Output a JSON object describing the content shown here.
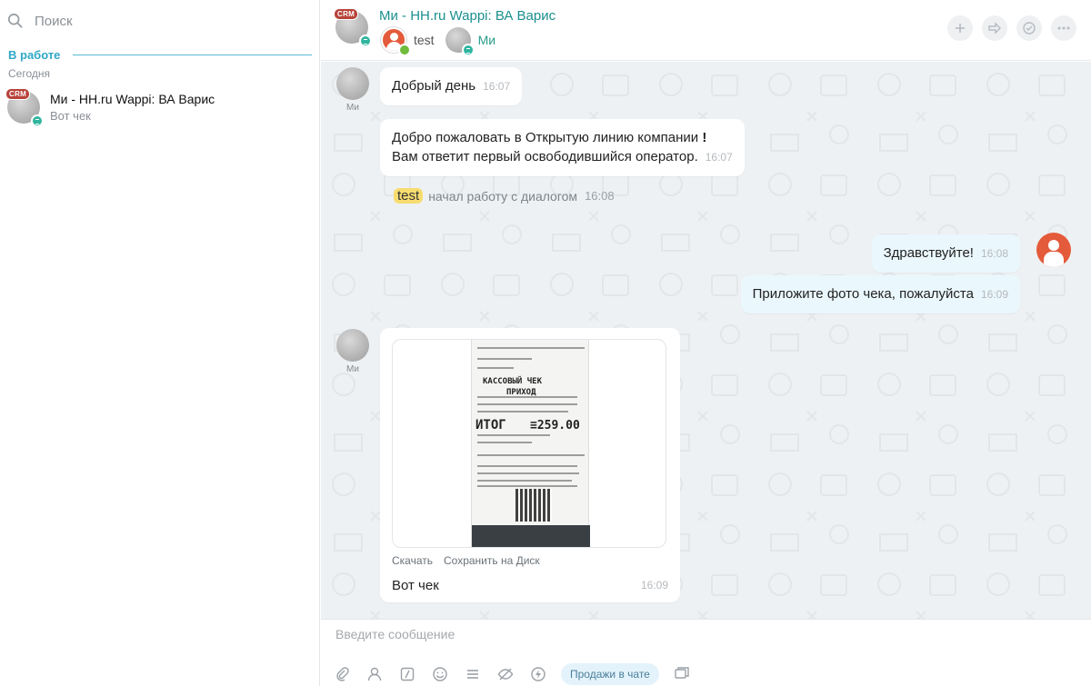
{
  "sidebar": {
    "search_placeholder": "Поиск",
    "section_title": "В работе",
    "day_label": "Сегодня",
    "chat": {
      "badge": "CRM",
      "name": "Ми - HH.ru Wappi: ВА Варис",
      "last_message": "Вот чек"
    }
  },
  "header": {
    "badge": "CRM",
    "title": "Ми - HH.ru Wappi: ВА Варис",
    "members": [
      {
        "label": "test"
      },
      {
        "label": "Ми"
      }
    ],
    "buttons": [
      "plus-icon",
      "forward-icon",
      "check-circle-icon",
      "more-icon"
    ]
  },
  "messages": [
    {
      "author": "Ми",
      "text": "Добрый день",
      "time": "16:07"
    },
    {
      "author": "",
      "text_line1": "Добро пожаловать в Открытую линию компании",
      "bang": "!",
      "text_line2": "Вам ответит первый освободившийся оператор.",
      "time": "16:07"
    },
    {
      "system_tag": "test",
      "system_text": "начал работу с диалогом",
      "time": "16:08"
    },
    {
      "text": "Здравствуйте!",
      "time": "16:08"
    },
    {
      "text": "Приложите фото чека, пожалуйста",
      "time": "16:09"
    },
    {
      "author": "Ми",
      "file_actions": [
        "Скачать",
        "Сохранить на Диск"
      ],
      "text": "Вот чек",
      "time": "16:09"
    }
  ],
  "receipt": {
    "line1": "КАССОВЫЙ ЧЕК",
    "line2": "ПРИХОД",
    "itog": "ИТОГ",
    "sum": "≡259.00"
  },
  "composer": {
    "placeholder": "Введите сообщение",
    "sales_button": "Продажи в чате",
    "tools": [
      "paperclip-icon",
      "user-icon",
      "slash-icon",
      "smile-icon",
      "list-icon",
      "eye-off-icon",
      "lightning-icon",
      "sales-button",
      "windows-icon"
    ]
  },
  "colors": {
    "accent": "#2fa7c7",
    "title": "#1b8f8f",
    "chat_bg": "#eef1f3",
    "out_bubble": "#eaf7fd"
  }
}
